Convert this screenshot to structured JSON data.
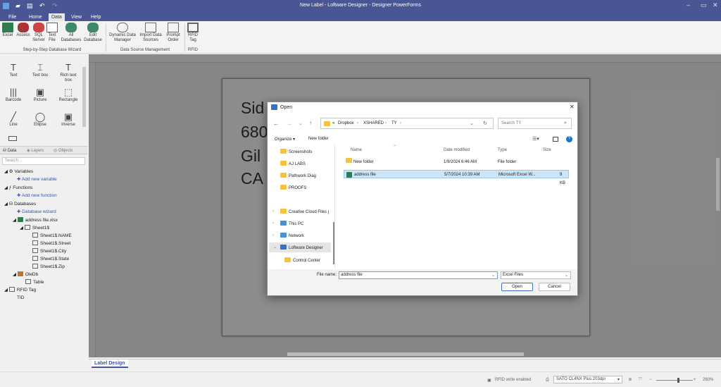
{
  "window": {
    "title": "New Label - Loftware Designer - Designer PowerForms"
  },
  "menu": [
    "File",
    "Home",
    "Data",
    "View",
    "Help"
  ],
  "ribbon": {
    "buttons": [
      {
        "label": "Excel"
      },
      {
        "label": "Access"
      },
      {
        "label": "SQL Server"
      },
      {
        "label": "Text File"
      },
      {
        "label": "All Databases"
      },
      {
        "label": "Edit Database"
      },
      {
        "label": "Dynamic Data Manager"
      },
      {
        "label": "Import Data Sources"
      },
      {
        "label": "Prompt Order"
      },
      {
        "label": "RFID Tag"
      }
    ],
    "groups": [
      "Step-by-Step Database Wizard",
      "Data Source Management",
      "RFID"
    ]
  },
  "toolbox": [
    {
      "label": "Text",
      "glyph": "T"
    },
    {
      "label": "Text box",
      "glyph": "⌶"
    },
    {
      "label": "Rich text box",
      "glyph": "T"
    },
    {
      "label": "Barcode",
      "glyph": "|||"
    },
    {
      "label": "Picture",
      "glyph": "▣"
    },
    {
      "label": "Rectangle",
      "glyph": "⬚"
    },
    {
      "label": "Line",
      "glyph": "╱"
    },
    {
      "label": "Ellipse",
      "glyph": "◯"
    },
    {
      "label": "Inverse",
      "glyph": "▣"
    }
  ],
  "panel_tabs": [
    "Data",
    "Layers",
    "Objects"
  ],
  "search_placeholder": "Search...",
  "tree": {
    "variables": "Variables",
    "add_variable": "Add new variable",
    "functions": "Functions",
    "add_function": "Add new function",
    "databases": "Databases",
    "database_wizard": "Database wizard",
    "address_file": "address file.xlsx",
    "sheet": "Sheet1$",
    "fields": [
      "Sheet1$.NAME",
      "Sheet1$.Street",
      "Sheet1$.City",
      "Sheet1$.State",
      "Sheet1$.Zip"
    ],
    "oledb": "OleDb",
    "table": "Table",
    "rfid_tag": "RFID Tag",
    "tid": "TID"
  },
  "label_text": [
    "Sid",
    "680",
    "Gil",
    "CA"
  ],
  "bottom_tab": "Label Design",
  "status": {
    "rfid": "RFID write enabled",
    "printer": "SATO CL4NX Plus 203dpi",
    "zoom": "260%"
  },
  "dialog": {
    "title": "Open",
    "breadcrumb": [
      "«",
      "Dropbox",
      "XSHARED",
      "TY"
    ],
    "search_placeholder": "Search TY",
    "organize": "Organize ▾",
    "new_folder": "New folder",
    "nav": [
      "Screenshots",
      "AJ LABS",
      "Pathwork Diag",
      "PROOFS",
      "Creative Cloud Files j",
      "This PC",
      "Network",
      "Loftware Designer",
      "Control Center"
    ],
    "columns": [
      "Name",
      "Date modified",
      "Type",
      "Size"
    ],
    "files": [
      {
        "name": "New folder",
        "date": "1/9/2024 6:46 AM",
        "type": "File folder",
        "size": ""
      },
      {
        "name": "address file",
        "date": "5/7/2024 10:39 AM",
        "type": "Microsoft Excel W...",
        "size": "9 KB"
      }
    ],
    "file_name_label": "File name:",
    "file_name_value": "address file",
    "filter_value": "Excel Files",
    "open": "Open",
    "cancel": "Cancel"
  },
  "colors": {
    "titlebar": "#4a5693",
    "accent": "#3a54a4",
    "selection": "#cce4f7"
  }
}
